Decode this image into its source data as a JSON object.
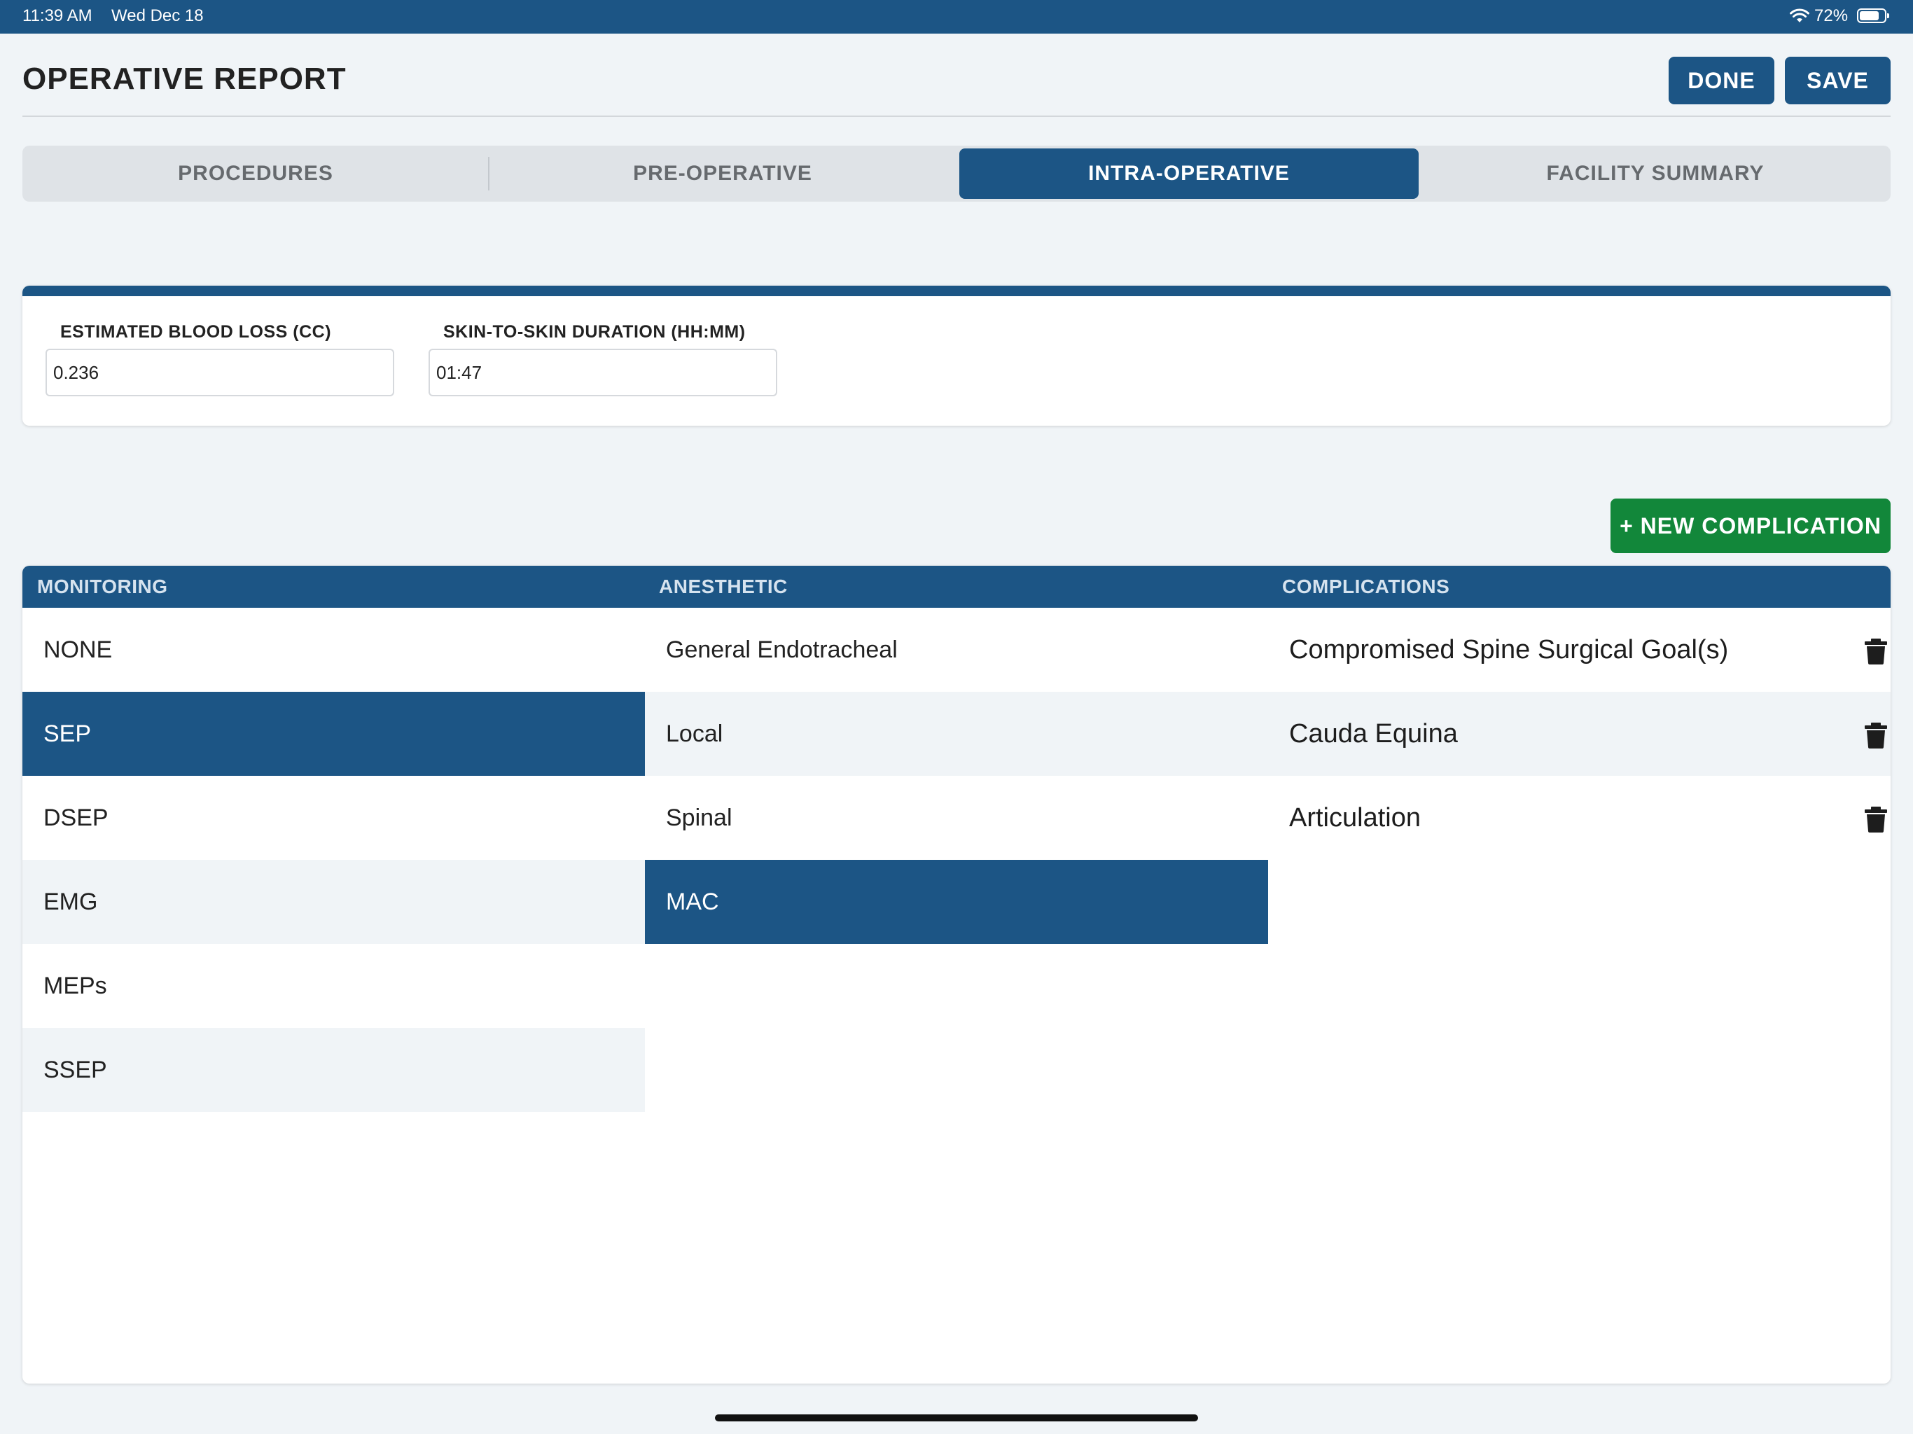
{
  "status_bar": {
    "time": "11:39 AM",
    "date": "Wed Dec 18",
    "battery_pct": "72%",
    "battery_level": 0.72
  },
  "header": {
    "title": "OPERATIVE REPORT",
    "done_label": "DONE",
    "save_label": "SAVE"
  },
  "tabs": [
    {
      "label": "PROCEDURES",
      "active": false
    },
    {
      "label": "PRE-OPERATIVE",
      "active": false
    },
    {
      "label": "INTRA-OPERATIVE",
      "active": true
    },
    {
      "label": "FACILITY SUMMARY",
      "active": false
    }
  ],
  "fields": {
    "blood_loss": {
      "label": "ESTIMATED BLOOD LOSS (CC)",
      "value": "0.236"
    },
    "duration": {
      "label": "SKIN-TO-SKIN DURATION (HH:MM)",
      "value": "01:47"
    }
  },
  "new_complication_label": "+ NEW COMPLICATION",
  "table": {
    "headers": {
      "monitoring": "MONITORING",
      "anesthetic": "ANESTHETIC",
      "complications": "COMPLICATIONS"
    },
    "monitoring": [
      {
        "label": "NONE",
        "selected": false
      },
      {
        "label": "SEP",
        "selected": true
      },
      {
        "label": "DSEP",
        "selected": false
      },
      {
        "label": "EMG",
        "selected": false
      },
      {
        "label": "MEPs",
        "selected": false
      },
      {
        "label": "SSEP",
        "selected": false
      }
    ],
    "anesthetic": [
      {
        "label": "General Endotracheal",
        "selected": false
      },
      {
        "label": "Local",
        "selected": false
      },
      {
        "label": "Spinal",
        "selected": false
      },
      {
        "label": "MAC",
        "selected": true
      }
    ],
    "complications": [
      {
        "label": "Compromised Spine Surgical Goal(s)"
      },
      {
        "label": "Cauda Equina"
      },
      {
        "label": "Articulation"
      }
    ]
  },
  "colors": {
    "primary": "#1c5585",
    "success": "#12873a",
    "background": "#f0f4f7"
  },
  "icons": {
    "delete": "trash-icon",
    "wifi": "wifi-icon",
    "battery": "battery-icon"
  }
}
